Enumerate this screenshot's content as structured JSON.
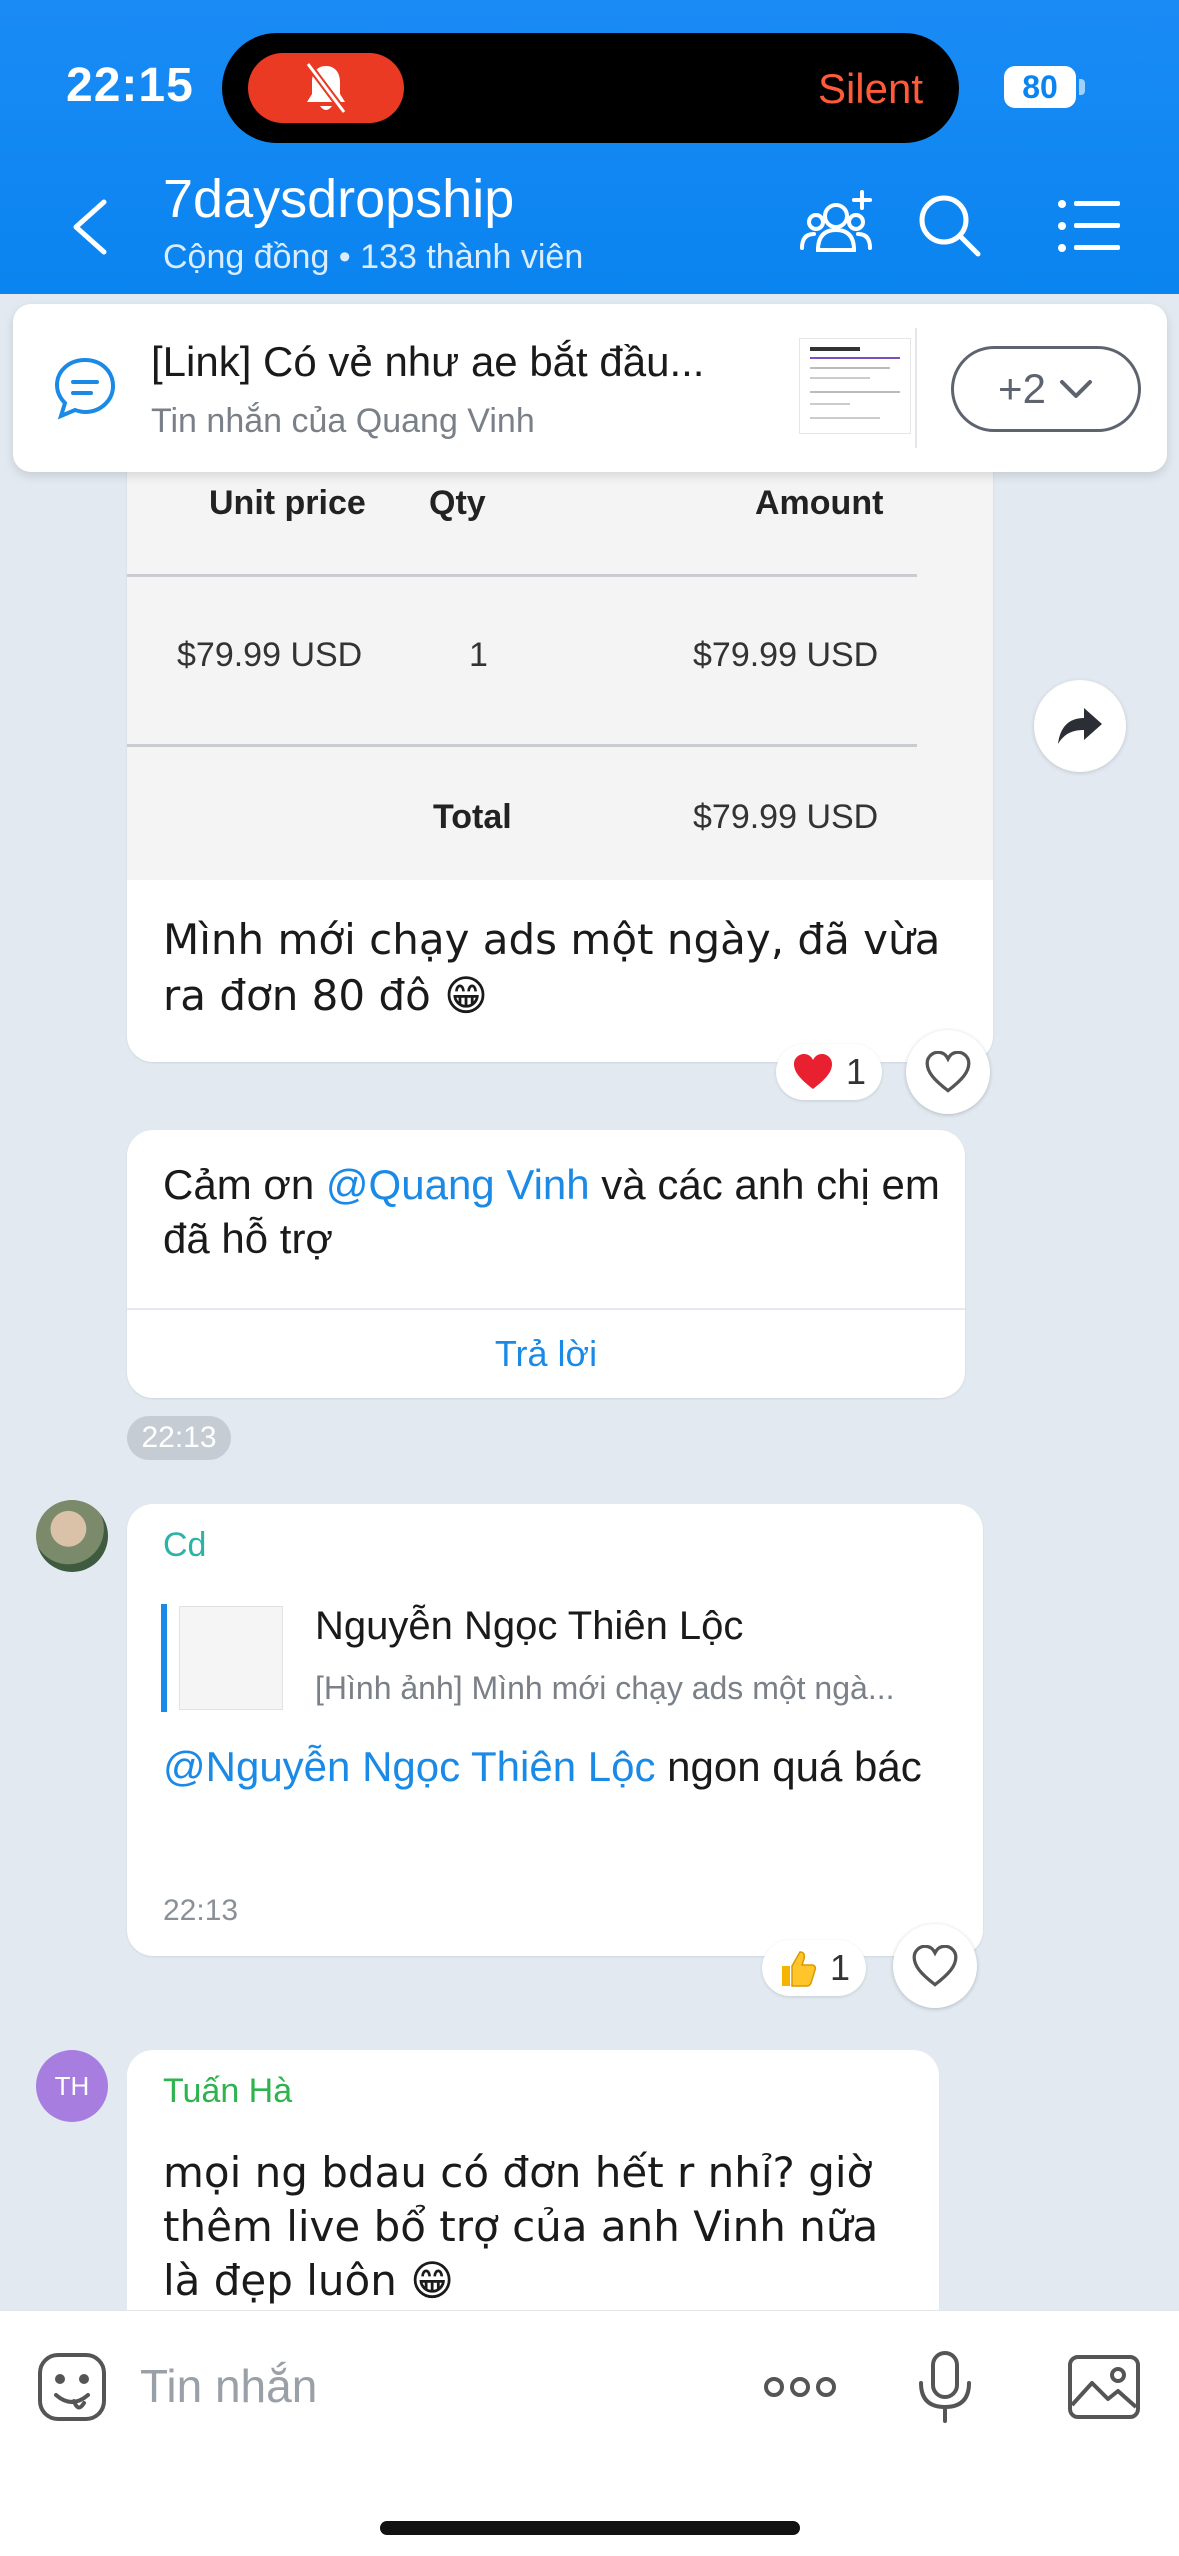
{
  "status_bar": {
    "time": "22:15",
    "silent_label": "Silent",
    "battery": "80"
  },
  "header": {
    "title": "7daysdropship",
    "subtitle": "Cộng đồng • 133 thành viên"
  },
  "pinned": {
    "title": "[Link] Có vẻ như ae bắt đầu...",
    "subtitle": "Tin nhắn của Quang Vinh",
    "more_label": "+2"
  },
  "receipt": {
    "headers": [
      "Unit price",
      "Qty",
      "Amount"
    ],
    "unit_price": "$79.99 USD",
    "qty": "1",
    "amount": "$79.99 USD",
    "total_label": "Total",
    "total": "$79.99 USD",
    "caption": "Mình mới chạy ads một ngày, đã vừa ra đơn 80 đô 😁",
    "reaction_count": "1"
  },
  "thanks_message": {
    "prefix": "Cảm ơn ",
    "mention": "@Quang Vinh",
    "suffix": " và các anh chị em đã hỗ trợ",
    "reply_label": "Trả lời",
    "time": "22:13"
  },
  "cd_message": {
    "sender": "Cd",
    "quote_name": "Nguyễn Ngọc Thiên Lộc",
    "quote_text": "[Hình ảnh] Mình mới chạy ads một ngà...",
    "mention": "@Nguyễn Ngọc Thiên Lộc",
    "text": " ngon quá bác",
    "time": "22:13",
    "reaction_count": "1"
  },
  "th_message": {
    "avatar_initials": "TH",
    "sender": "Tuấn Hà",
    "text": "mọi ng bdau có đơn hết r nhỉ? giờ thêm live bổ trợ của anh Vinh nữa là đẹp luôn 😁"
  },
  "input": {
    "placeholder": "Tin nhắn"
  },
  "colors": {
    "header_blue": "#0a84f0",
    "link_blue": "#1a8ae6",
    "heart_red": "#e8202f"
  }
}
